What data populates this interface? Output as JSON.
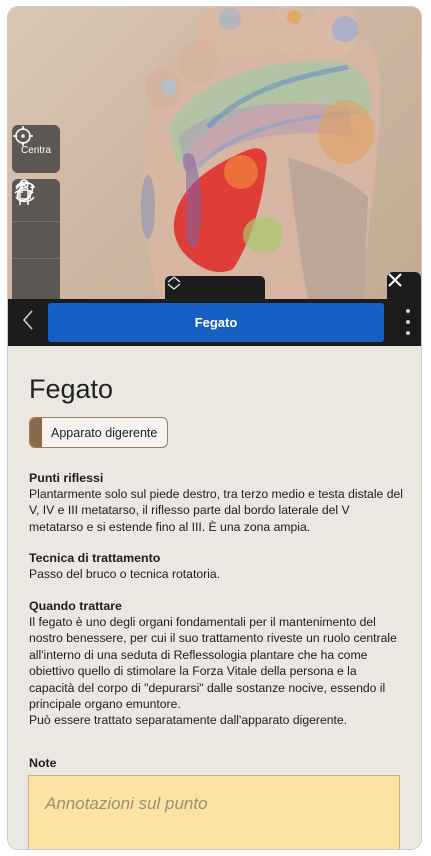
{
  "viewer": {
    "centra_label": "Centra",
    "colors": {
      "liver": "#e0302b",
      "skin": "#d6b5a2"
    }
  },
  "topbar": {
    "title": "Fegato"
  },
  "content": {
    "title": "Fegato",
    "tag": "Apparato digerente",
    "sections": [
      {
        "heading": "Punti riflessi",
        "body": [
          "Plantarmente solo sul piede destro, tra terzo medio e testa distale del V, IV e III metatarso, il riflesso parte dal bordo laterale del V metatarso e si estende fino al III. È una zona ampia."
        ]
      },
      {
        "heading": "Tecnica di trattamento",
        "body": [
          "Passo del bruco o tecnica rotatoria."
        ]
      },
      {
        "heading": "Quando trattare",
        "body": [
          "Il fegato è uno degli organi fondamentali per il mantenimento del nostro benessere, per cui il suo trattamento riveste un ruolo centrale all'interno di una seduta di Reflessologia plantare che ha come obiettivo quello di stimolare la Forza Vitale della persona e la capacità del corpo di \"depurarsi\" dalle sostanze nocive, essendo il principale organo emuntore.",
          "Può essere trattato separatamente dall'apparato digerente."
        ]
      }
    ],
    "notes": {
      "label": "Note",
      "placeholder": "Annotazioni sul punto"
    }
  }
}
